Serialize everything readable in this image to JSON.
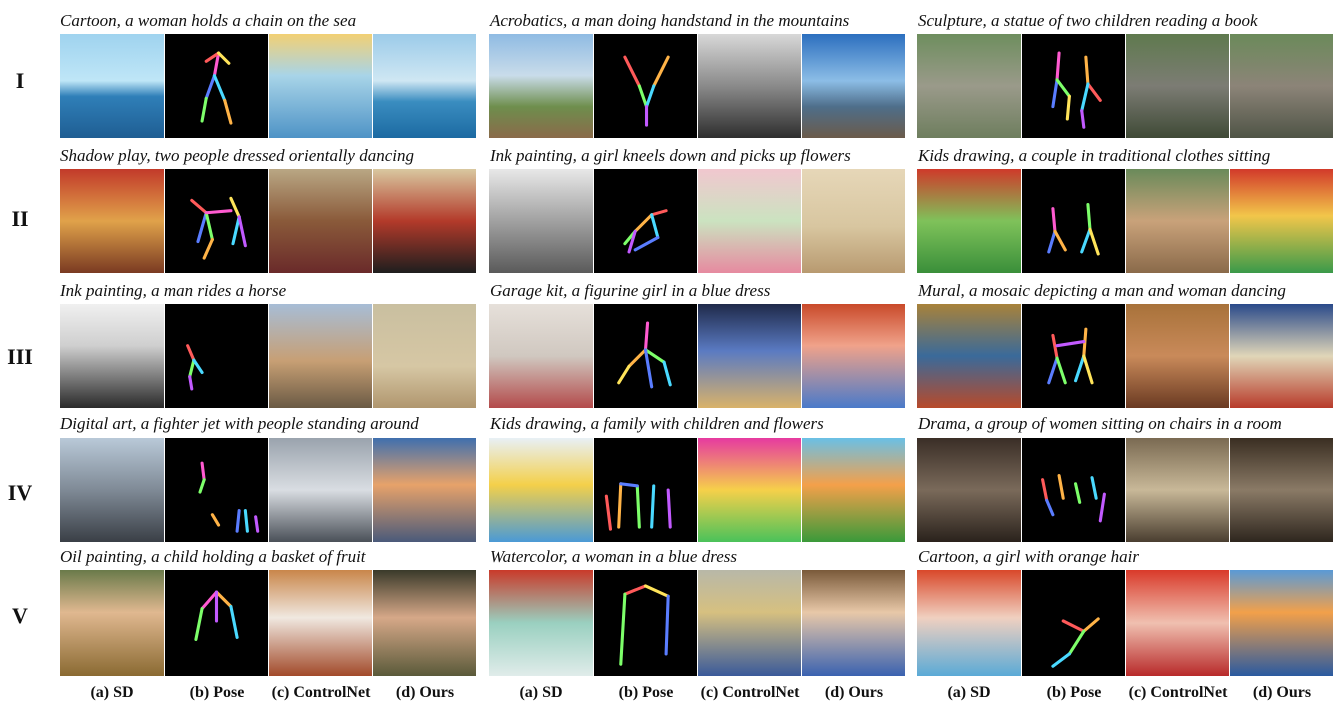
{
  "row_labels": [
    "I",
    "II",
    "III",
    "IV",
    "V"
  ],
  "column_labels": [
    "(a) SD",
    "(b) Pose",
    "(c) ControlNet",
    "(d) Ours"
  ],
  "captions": [
    [
      "Cartoon, a woman holds a chain on the sea",
      "Acrobatics, a man doing handstand in the mountains",
      "Sculpture, a statue of two children reading a book"
    ],
    [
      "Shadow play, two people dressed orientally dancing",
      "Ink painting, a girl kneels down and picks up flowers",
      "Kids drawing, a couple in traditional clothes sitting"
    ],
    [
      "Ink painting, a man rides a horse",
      "Garage kit, a figurine girl in a blue dress",
      "Mural, a mosaic depicting a man and woman dancing"
    ],
    [
      "Digital art, a fighter jet with people standing around",
      "Kids drawing, a family with children and flowers",
      "Drama, a group of women sitting on chairs in a room"
    ],
    [
      "Oil painting, a child holding a basket of fruit",
      "Watercolor, a woman in a blue dress",
      "Cartoon, a girl with orange hair"
    ]
  ],
  "skeleton_colors": [
    "#ff5a5a",
    "#ffb347",
    "#ffe45a",
    "#7dff6a",
    "#4ad9ff",
    "#5a7dff",
    "#c25aff",
    "#ff5ad0"
  ]
}
